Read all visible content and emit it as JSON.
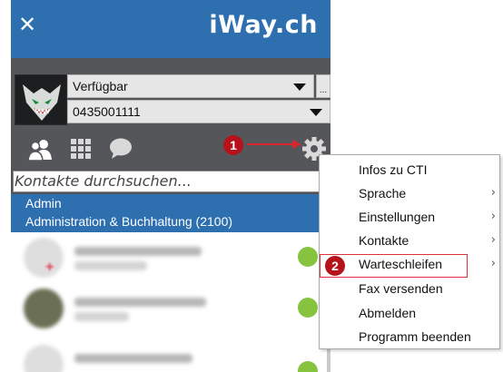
{
  "header": {
    "close_symbol": "✕",
    "logo_text": "iWay.ch"
  },
  "status": {
    "availability": "Verfügbar",
    "number": "0435001111",
    "more_label": "..."
  },
  "search": {
    "placeholder": "Kontakte durchsuchen..."
  },
  "group": {
    "name": "Admin",
    "subtitle": "Administration & Buchhaltung (2100)"
  },
  "annotations": {
    "badge1": "1",
    "badge2": "2"
  },
  "icons": [
    "close-icon",
    "users-icon",
    "dialpad-icon",
    "chat-icon",
    "gear-icon",
    "phone-icon",
    "chevron-right-icon",
    "arrow-right-icon"
  ],
  "colors": {
    "brand_blue": "#2e6fb0",
    "panel_gray": "#54565a",
    "annotation_red": "#b5121b",
    "phone_green": "#86c440"
  },
  "menu": {
    "items": [
      {
        "label": "Infos zu  CTI",
        "submenu": false
      },
      {
        "label": "Sprache",
        "submenu": true
      },
      {
        "label": "Einstellungen",
        "submenu": true
      },
      {
        "label": "Kontakte",
        "submenu": true
      },
      {
        "label": "Warteschleifen",
        "submenu": true
      },
      {
        "label": "Fax versenden",
        "submenu": false
      },
      {
        "label": "Abmelden",
        "submenu": false
      },
      {
        "label": "Programm beenden",
        "submenu": false
      }
    ],
    "chevron": "›"
  }
}
